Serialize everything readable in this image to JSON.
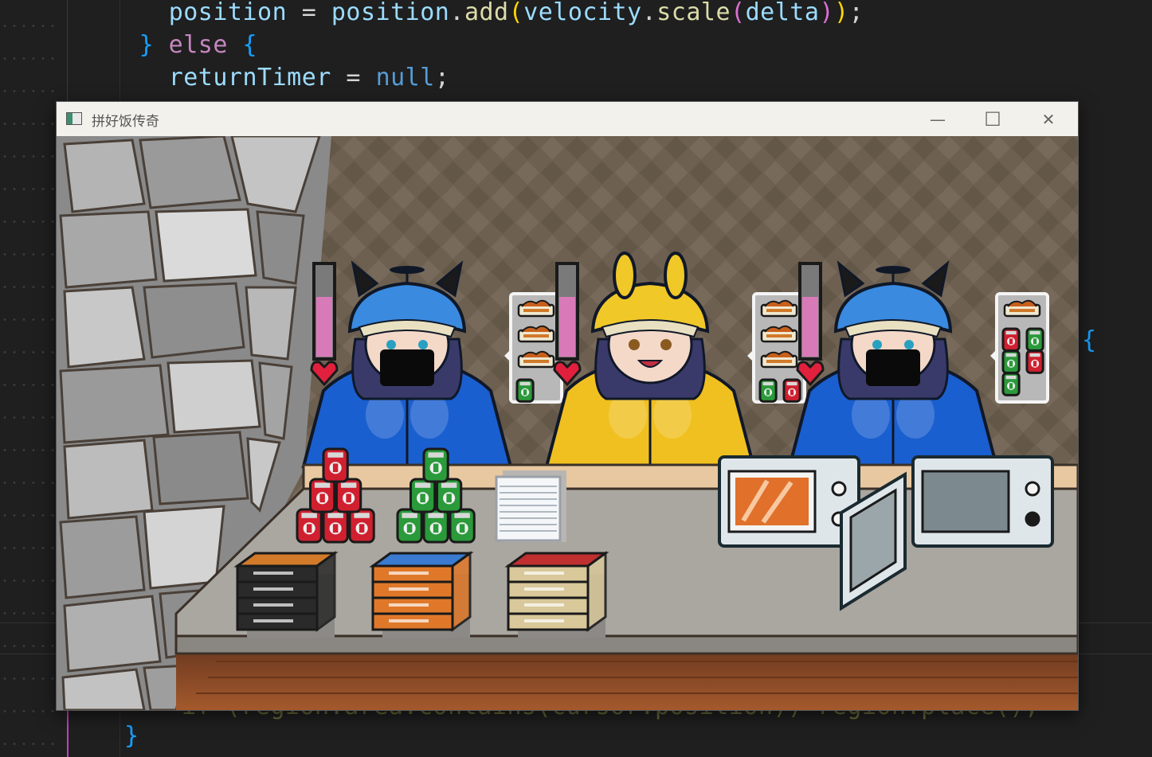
{
  "editor": {
    "lines": [
      {
        "indent": "   ",
        "parts": [
          [
            "position",
            "var"
          ],
          [
            " = ",
            "pun"
          ],
          [
            "position",
            "var"
          ],
          [
            ".",
            "pun"
          ],
          [
            "add",
            "fn"
          ],
          [
            "(",
            "br1"
          ],
          [
            "velocity",
            "var"
          ],
          [
            ".",
            "pun"
          ],
          [
            "scale",
            "fn"
          ],
          [
            "(",
            "br2"
          ],
          [
            "delta",
            "var"
          ],
          [
            ")",
            "br2"
          ],
          [
            ")",
            "br1"
          ],
          [
            ";",
            "pun"
          ]
        ]
      },
      {
        "indent": " ",
        "parts": [
          [
            "}",
            "br3"
          ],
          [
            " else ",
            "kw-purple"
          ],
          [
            "{",
            "br3"
          ]
        ]
      },
      {
        "indent": "   ",
        "parts": [
          [
            "returnTimer",
            "var"
          ],
          [
            " = ",
            "pun"
          ],
          [
            "null",
            "kw-blue"
          ],
          [
            ";",
            "pun"
          ]
        ]
      }
    ],
    "right_brace": "{",
    "bottom_partial": "if (region.area.contains(cursor.position)) region.place();",
    "bottom_brace": "}"
  },
  "window": {
    "title": "拼好饭传奇",
    "minimize_glyph": "—",
    "maximize_glyph": "☐",
    "close_glyph": "✕"
  },
  "game": {
    "customers": [
      {
        "outfit": "blue",
        "patience": 0.65,
        "order": [
          "food",
          "food",
          "food",
          "green-can"
        ]
      },
      {
        "outfit": "yellow",
        "patience": 0.65,
        "order": [
          "food",
          "food",
          "food",
          "green-can",
          "red-can"
        ]
      },
      {
        "outfit": "blue",
        "patience": 0.65,
        "order": [
          "food",
          "red-can",
          "green-can",
          "green-can",
          "red-can",
          "green-can"
        ]
      }
    ],
    "colors": {
      "patience_fill": "#d87ab8",
      "heart": "#e0203c",
      "blue_outfit": "#1a5fd0",
      "yellow_outfit": "#f0c020",
      "wall_bg": "#6d6050",
      "counter_top": "#a9a49d",
      "floor": "#8b4a26"
    },
    "counter_items": [
      {
        "type": "red-can-stack",
        "count": 6
      },
      {
        "type": "green-can-stack",
        "count": 6
      },
      {
        "type": "plate-stack"
      },
      {
        "type": "black-box-stack",
        "count": 4
      },
      {
        "type": "orange-box-stack",
        "count": 4
      },
      {
        "type": "beige-box-stack",
        "count": 4
      },
      {
        "type": "microwave-closed"
      },
      {
        "type": "microwave-open"
      }
    ]
  }
}
